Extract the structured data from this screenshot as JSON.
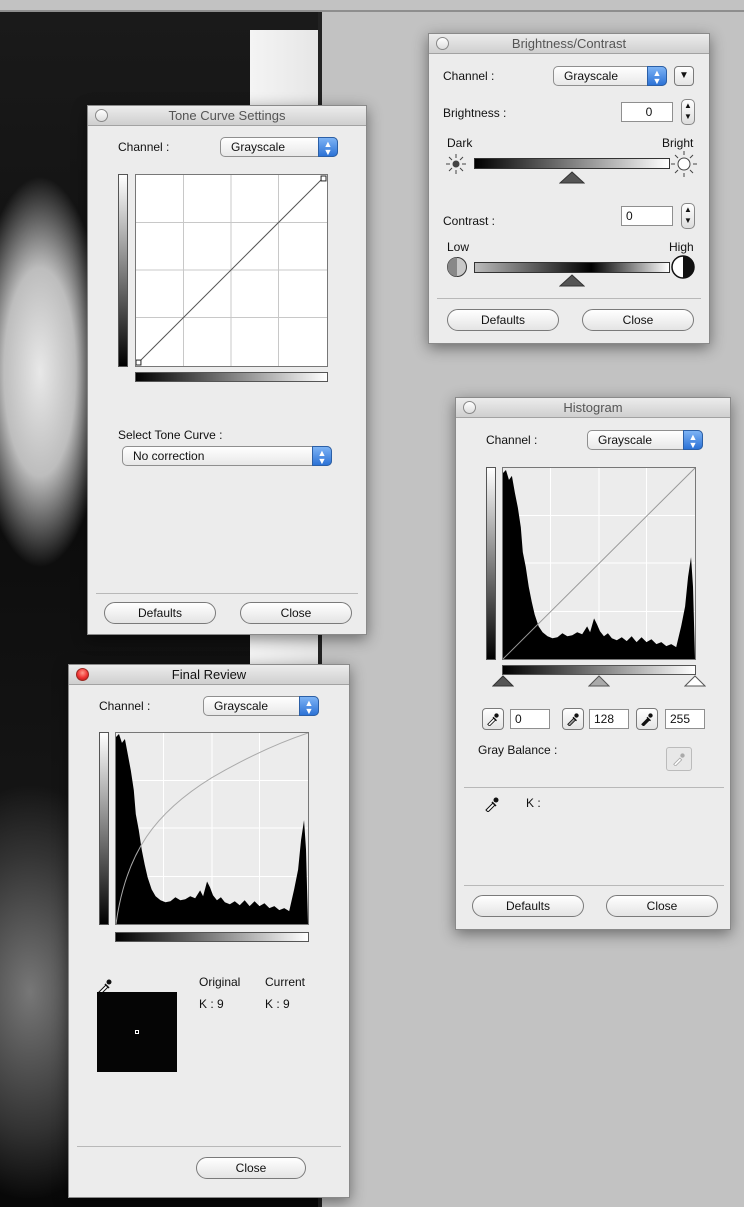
{
  "tone_curve": {
    "title": "Tone Curve Settings",
    "channel_label": "Channel :",
    "channel_value": "Grayscale",
    "select_tone_curve_label": "Select Tone Curve :",
    "select_tone_curve_value": "No correction",
    "defaults_label": "Defaults",
    "close_label": "Close"
  },
  "brightness_contrast": {
    "title": "Brightness/Contrast",
    "channel_label": "Channel :",
    "channel_value": "Grayscale",
    "brightness_label": "Brightness :",
    "brightness_value": "0",
    "dark_label": "Dark",
    "bright_label": "Bright",
    "contrast_label": "Contrast :",
    "contrast_value": "0",
    "low_label": "Low",
    "high_label": "High",
    "defaults_label": "Defaults",
    "close_label": "Close"
  },
  "histogram": {
    "title": "Histogram",
    "channel_label": "Channel :",
    "channel_value": "Grayscale",
    "black_point": "0",
    "gray_point": "128",
    "white_point": "255",
    "gray_balance_label": "Gray Balance :",
    "k_label": "K :",
    "defaults_label": "Defaults",
    "close_label": "Close"
  },
  "final_review": {
    "title": "Final Review",
    "channel_label": "Channel :",
    "channel_value": "Grayscale",
    "original_label": "Original",
    "current_label": "Current",
    "original_k": "K :  9",
    "current_k": "K :  9",
    "close_label": "Close"
  },
  "icons": [
    "eyedropper-icon",
    "sun-dark-icon",
    "sun-bright-icon",
    "contrast-low-icon",
    "contrast-high-icon",
    "popup-arrows-icon",
    "window-close-icon"
  ]
}
